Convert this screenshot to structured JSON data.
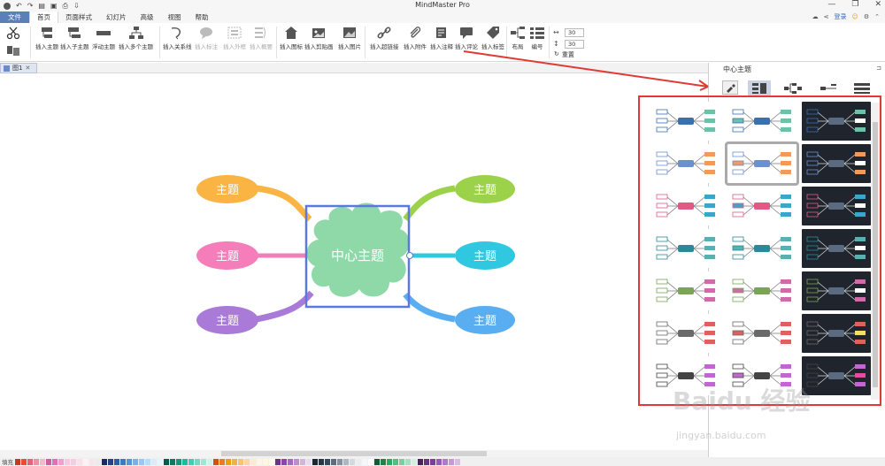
{
  "app": {
    "title": "MindMaster Pro",
    "quick_access": [
      "↶",
      "↷",
      "▤",
      "▣",
      "⎙",
      "⇩"
    ],
    "window_buttons": [
      "—",
      "❐",
      "✕"
    ]
  },
  "menubar": {
    "file": "文件",
    "items": [
      "首页",
      "页面样式",
      "幻灯片",
      "高级",
      "视图",
      "帮助"
    ],
    "active_index": 0,
    "login": "登录"
  },
  "ribbon": {
    "buttons": [
      {
        "label": "插入主题",
        "dim": false
      },
      {
        "label": "插入子主题",
        "dim": false
      },
      {
        "label": "浮动主题",
        "dim": false
      },
      {
        "label": "插入多个主题",
        "dim": false
      },
      {
        "label": "插入关系线",
        "dim": false
      },
      {
        "label": "插入标注",
        "dim": true
      },
      {
        "label": "插入外框",
        "dim": true
      },
      {
        "label": "插入概要",
        "dim": true
      },
      {
        "label": "插入图标",
        "dim": false
      },
      {
        "label": "插入剪贴画",
        "dim": false
      },
      {
        "label": "插入图片",
        "dim": false
      },
      {
        "label": "插入超链接",
        "dim": false
      },
      {
        "label": "插入附件",
        "dim": false
      },
      {
        "label": "插入注释",
        "dim": false
      },
      {
        "label": "插入评论",
        "dim": false
      },
      {
        "label": "插入标签",
        "dim": false
      },
      {
        "label": "布局",
        "dim": false
      },
      {
        "label": "编号",
        "dim": false
      }
    ],
    "spin1": "30",
    "spin2": "30",
    "reset": "重置"
  },
  "doc_tab": {
    "label": "图1"
  },
  "mindmap": {
    "center": "中心主题",
    "topics": [
      "主题",
      "主题",
      "主题",
      "主题",
      "主题",
      "主题"
    ],
    "colors": {
      "center": "#8fd8a8",
      "orange": "#f9b444",
      "pink": "#f57eba",
      "purple": "#a97ad8",
      "green": "#9bd24a",
      "cyan": "#30c8e0",
      "blue": "#58aef0",
      "selection": "#5b78e0"
    }
  },
  "panel": {
    "title": "中心主题"
  },
  "annotation": {
    "color": "#e03a35"
  },
  "palette": {
    "label": "填充"
  },
  "watermark": {
    "main": "Baidu 经验",
    "sub": "jingyan.baidu.com"
  }
}
